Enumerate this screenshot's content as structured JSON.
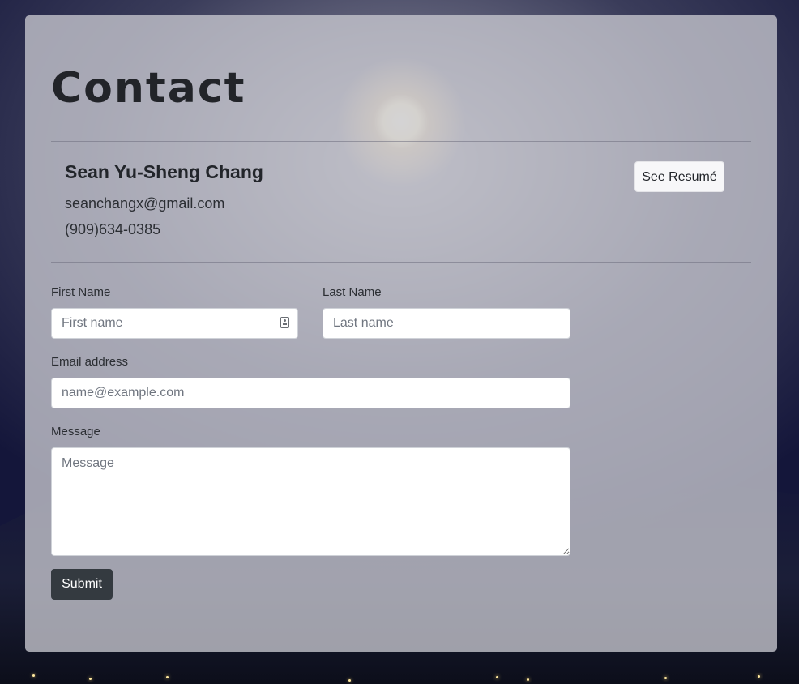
{
  "page": {
    "title": "Contact"
  },
  "contact": {
    "name": "Sean Yu-Sheng Chang",
    "email": "seanchangx@gmail.com",
    "phone": "(909)634-0385",
    "resume_button": "See Resumé"
  },
  "form": {
    "first_name": {
      "label": "First Name",
      "placeholder": "First name",
      "value": ""
    },
    "last_name": {
      "label": "Last Name",
      "placeholder": "Last name",
      "value": ""
    },
    "email": {
      "label": "Email address",
      "placeholder": "name@example.com",
      "value": ""
    },
    "message": {
      "label": "Message",
      "placeholder": "Message",
      "value": ""
    },
    "submit_label": "Submit"
  },
  "icons": {
    "autofill": "contact-card-icon"
  },
  "colors": {
    "card_background": "#c8c8d0",
    "submit_button": "#343a40",
    "text": "#22252a"
  }
}
